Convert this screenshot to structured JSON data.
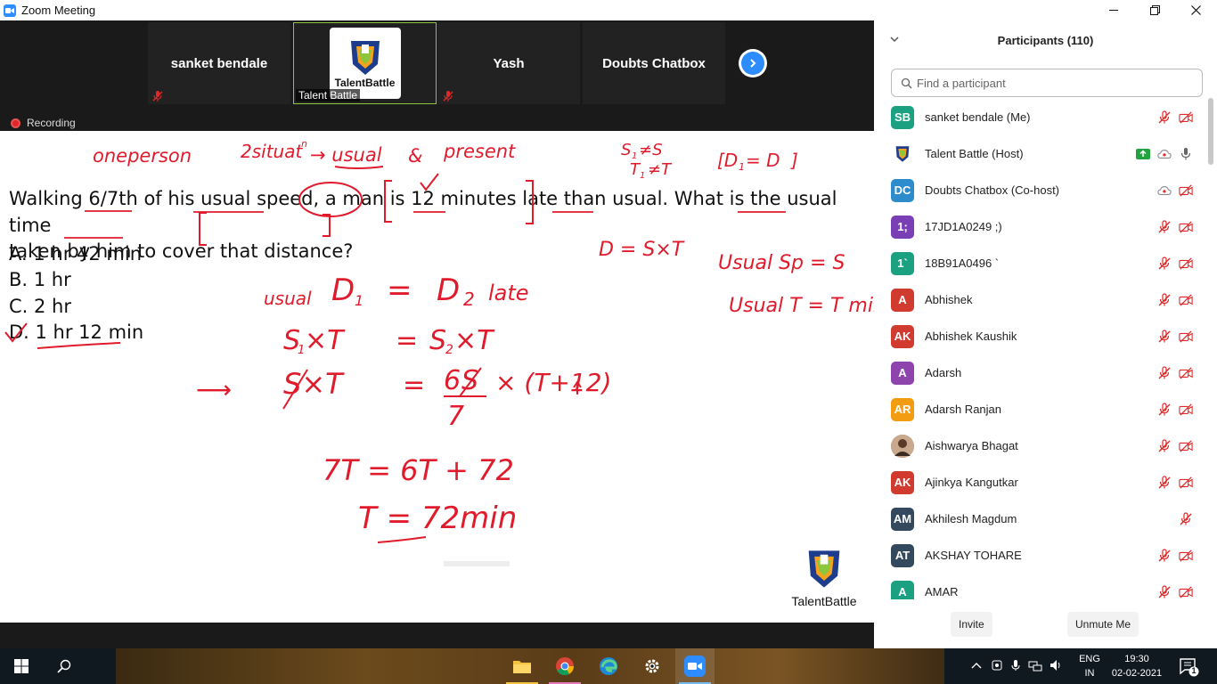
{
  "window": {
    "title": "Zoom Meeting",
    "controls": [
      "minimize",
      "restore",
      "close"
    ]
  },
  "video_strip": {
    "tiles": [
      {
        "name": "sanket bendale",
        "muted": true
      },
      {
        "name": "Talent Battle",
        "logo_text": "TalentBattle",
        "active": true
      },
      {
        "name": "Yash",
        "muted": true
      },
      {
        "name": "Doubts Chatbox",
        "muted": false
      }
    ],
    "recording_label": "Recording"
  },
  "content": {
    "question_line1": "Walking 6/7th of his usual speed, a man is 12 minutes late than usual. What is the usual time",
    "question_line2": "taken by him to cover that distance?",
    "options": [
      "A. 1 hr 42 min",
      "B. 1 hr",
      "C. 2 hr",
      "D. 1 hr 12 min"
    ],
    "annotations": {
      "a1": "oneperson",
      "a2": "2situat",
      "a2b": "n",
      "a3": "→ usual",
      "a4": "&",
      "a5": "present",
      "a6": "S",
      "a7": "≠S",
      "a8": "T",
      "a9": "≠T",
      "a10": "[D",
      "a11": "= D",
      "a12": "]",
      "a13": "D = S×T",
      "a14": "Usual Sp = S",
      "a15": "Usual T = T min",
      "a16": "usual",
      "a17": "D",
      "a18": "=",
      "a19": "D",
      "a20": "late",
      "a21": "S",
      "a22": "×T",
      "a23": "=",
      "a24": "S",
      "a25": "×T",
      "a26": "S×T",
      "a27": "=",
      "a28": "6",
      "a29": "S",
      "a30": "× (T+12)",
      "a31": "7",
      "a32": "7T = 6T + 72",
      "a33": "T = 72min",
      "sub1": "1",
      "sub2": "2",
      "arrow": "⟶"
    },
    "watermark_text": "TalentBattle"
  },
  "participants": {
    "header": "Participants (110)",
    "search_placeholder": "Find a participant",
    "list": [
      {
        "initials": "SB",
        "name": "sanket bendale (Me)",
        "color": "#1ba082",
        "icons": [
          "mic-off",
          "video-off"
        ]
      },
      {
        "initials": "",
        "name": "Talent Battle (Host)",
        "color": "#ffffff",
        "logo": true,
        "icons": [
          "share",
          "cloud",
          "mic-on"
        ]
      },
      {
        "initials": "DC",
        "name": "Doubts Chatbox (Co-host)",
        "color": "#2d8ccc",
        "icons": [
          "cloud",
          "video-off"
        ]
      },
      {
        "initials": "1;",
        "name": "17JD1A0249 ;)",
        "color": "#7b3fb5",
        "icons": [
          "mic-off",
          "video-off"
        ]
      },
      {
        "initials": "1`",
        "name": "18B91A0496 `",
        "color": "#1ba082",
        "icons": [
          "mic-off",
          "video-off"
        ]
      },
      {
        "initials": "A",
        "name": "Abhishek",
        "color": "#d13b2f",
        "icons": [
          "mic-off",
          "video-off"
        ]
      },
      {
        "initials": "AK",
        "name": "Abhishek Kaushik",
        "color": "#d13b2f",
        "icons": [
          "mic-off",
          "video-off"
        ]
      },
      {
        "initials": "A",
        "name": "Adarsh",
        "color": "#8e44ad",
        "icons": [
          "mic-off",
          "video-off"
        ]
      },
      {
        "initials": "AR",
        "name": "Adarsh Ranjan",
        "color": "#f39c12",
        "icons": [
          "mic-off",
          "video-off"
        ]
      },
      {
        "initials": "",
        "name": "Aishwarya Bhagat",
        "color": "#9a7a64",
        "photo": true,
        "icons": [
          "mic-off",
          "video-off"
        ]
      },
      {
        "initials": "AK",
        "name": "Ajinkya Kangutkar",
        "color": "#d13b2f",
        "icons": [
          "mic-off",
          "video-off"
        ]
      },
      {
        "initials": "AM",
        "name": "Akhilesh Magdum",
        "color": "#34495e",
        "icons": [
          "mic-off"
        ]
      },
      {
        "initials": "AT",
        "name": "AKSHAY TOHARE",
        "color": "#34495e",
        "icons": [
          "mic-off",
          "video-off"
        ]
      },
      {
        "initials": "A",
        "name": "AMAR",
        "color": "#1ba082",
        "icons": [
          "mic-off",
          "video-off"
        ]
      }
    ],
    "invite_label": "Invite",
    "unmute_label": "Unmute Me"
  },
  "taskbar": {
    "apps": [
      "file-explorer",
      "chrome",
      "edge",
      "settings",
      "zoom"
    ],
    "lang_line1": "ENG",
    "lang_line2": "IN",
    "time": "19:30",
    "date": "02-02-2021",
    "notification_count": "1"
  },
  "colors": {
    "ink": "#e01b2c",
    "zoom_blue": "#2d8cff",
    "dark_bg": "#1a1a1a"
  }
}
